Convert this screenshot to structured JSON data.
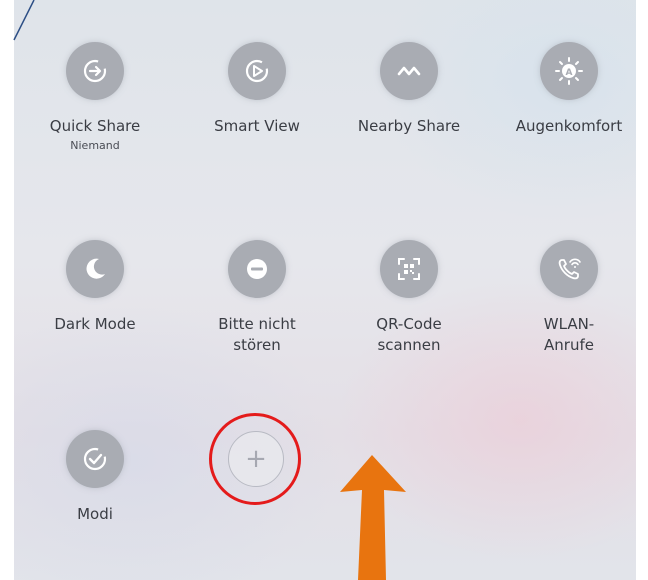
{
  "tiles": [
    {
      "id": "quick-share",
      "label": "Quick Share",
      "sublabel": "Niemand",
      "icon": "quick-share-icon"
    },
    {
      "id": "smart-view",
      "label": "Smart View",
      "icon": "smart-view-icon"
    },
    {
      "id": "nearby-share",
      "label": "Nearby Share",
      "icon": "nearby-share-icon"
    },
    {
      "id": "augenkomfort",
      "label": "Augenkomfort",
      "icon": "eye-comfort-icon"
    },
    {
      "id": "dark-mode",
      "label": "Dark Mode",
      "icon": "moon-icon"
    },
    {
      "id": "bitte-nicht-stoeren",
      "label": "Bitte nicht\nstören",
      "icon": "do-not-disturb-icon"
    },
    {
      "id": "qr-code",
      "label": "QR-Code\nscannen",
      "icon": "qr-scan-icon"
    },
    {
      "id": "wlan-anrufe",
      "label": "WLAN-\nAnrufe",
      "icon": "wifi-call-icon"
    },
    {
      "id": "modi",
      "label": "Modi",
      "icon": "modes-icon"
    }
  ],
  "add_button": {
    "glyph": "+",
    "icon": "plus-icon"
  },
  "annotations": {
    "highlight_color": "#e41b1b",
    "arrow_color": "#e8740f"
  }
}
